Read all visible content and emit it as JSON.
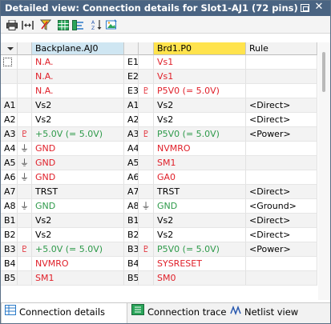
{
  "window": {
    "title": "Detailed view: Connection details for Slot1-AJ1 (72 pins)"
  },
  "toolbar": {
    "icons": [
      "print-icon",
      "fit-columns-icon",
      "filter-icon",
      "grid-icon",
      "trace-icon",
      "sort-az-icon",
      "image-icon"
    ]
  },
  "columns": {
    "sort": "",
    "left": "Backplane.AJ0",
    "right": "Brd1.P0",
    "rule": "Rule"
  },
  "colors": {
    "red": "#e0202a",
    "green": "#2e9a4a",
    "header_blue": "#cfe6f2",
    "header_yellow": "#ffe34d",
    "titlebar": "#4a6482"
  },
  "rows": [
    {
      "lpin": "",
      "lsym": "",
      "lnet": "N.A.",
      "lcolor": "red",
      "rpin": "E1",
      "rsym": "",
      "rnet": "Vs1",
      "rcolor": "red",
      "rule": "",
      "checkbox": true
    },
    {
      "lpin": "",
      "lsym": "",
      "lnet": "N.A.",
      "lcolor": "red",
      "rpin": "E2",
      "rsym": "",
      "rnet": "Vs1",
      "rcolor": "red",
      "rule": ""
    },
    {
      "lpin": "",
      "lsym": "",
      "lnet": "N.A.",
      "lcolor": "red",
      "rpin": "E3",
      "rsym": "power",
      "rnet": "P5V0 (= 5.0V)",
      "rcolor": "red",
      "rule": ""
    },
    {
      "lpin": "A1",
      "lsym": "",
      "lnet": "Vs2",
      "lcolor": "black",
      "rpin": "A1",
      "rsym": "",
      "rnet": "Vs2",
      "rcolor": "black",
      "rule": "<Direct>"
    },
    {
      "lpin": "A2",
      "lsym": "",
      "lnet": "Vs2",
      "lcolor": "black",
      "rpin": "A2",
      "rsym": "",
      "rnet": "Vs2",
      "rcolor": "black",
      "rule": "<Direct>"
    },
    {
      "lpin": "A3",
      "lsym": "power",
      "lnet": "+5.0V (= 5.0V)",
      "lcolor": "green",
      "rpin": "A3",
      "rsym": "power",
      "rnet": "P5V0 (= 5.0V)",
      "rcolor": "green",
      "rule": "<Power>"
    },
    {
      "lpin": "A4",
      "lsym": "ground",
      "lnet": "GND",
      "lcolor": "red",
      "rpin": "A4",
      "rsym": "",
      "rnet": "NVMRO",
      "rcolor": "red",
      "rule": ""
    },
    {
      "lpin": "A5",
      "lsym": "ground",
      "lnet": "GND",
      "lcolor": "red",
      "rpin": "A5",
      "rsym": "",
      "rnet": "SM1",
      "rcolor": "red",
      "rule": ""
    },
    {
      "lpin": "A6",
      "lsym": "ground",
      "lnet": "GND",
      "lcolor": "red",
      "rpin": "A6",
      "rsym": "",
      "rnet": "GA0",
      "rcolor": "red",
      "rule": ""
    },
    {
      "lpin": "A7",
      "lsym": "",
      "lnet": "TRST",
      "lcolor": "black",
      "rpin": "A7",
      "rsym": "",
      "rnet": "TRST",
      "rcolor": "black",
      "rule": "<Direct>"
    },
    {
      "lpin": "A8",
      "lsym": "ground",
      "lnet": "GND",
      "lcolor": "green",
      "rpin": "A8",
      "rsym": "ground",
      "rnet": "GND",
      "rcolor": "green",
      "rule": "<Ground>"
    },
    {
      "lpin": "B1",
      "lsym": "",
      "lnet": "Vs2",
      "lcolor": "black",
      "rpin": "B1",
      "rsym": "",
      "rnet": "Vs2",
      "rcolor": "black",
      "rule": "<Direct>"
    },
    {
      "lpin": "B2",
      "lsym": "",
      "lnet": "Vs2",
      "lcolor": "black",
      "rpin": "B2",
      "rsym": "",
      "rnet": "Vs2",
      "rcolor": "black",
      "rule": "<Direct>"
    },
    {
      "lpin": "B3",
      "lsym": "power",
      "lnet": "+5.0V (= 5.0V)",
      "lcolor": "green",
      "rpin": "B3",
      "rsym": "power",
      "rnet": "P5V0 (= 5.0V)",
      "rcolor": "green",
      "rule": "<Power>"
    },
    {
      "lpin": "B4",
      "lsym": "",
      "lnet": "NVMRO",
      "lcolor": "red",
      "rpin": "B4",
      "rsym": "",
      "rnet": "SYSRESET",
      "rcolor": "red",
      "rule": ""
    },
    {
      "lpin": "B5",
      "lsym": "",
      "lnet": "SM1",
      "lcolor": "red",
      "rpin": "B5",
      "rsym": "",
      "rnet": "SM0",
      "rcolor": "red",
      "rule": ""
    }
  ],
  "tabs": [
    {
      "label": "Connection details",
      "icon": "connection-details-icon",
      "active": true
    },
    {
      "label": "Connection trace",
      "icon": "connection-trace-icon",
      "active": false
    },
    {
      "label": "Netlist view",
      "icon": "netlist-icon",
      "active": false
    }
  ]
}
